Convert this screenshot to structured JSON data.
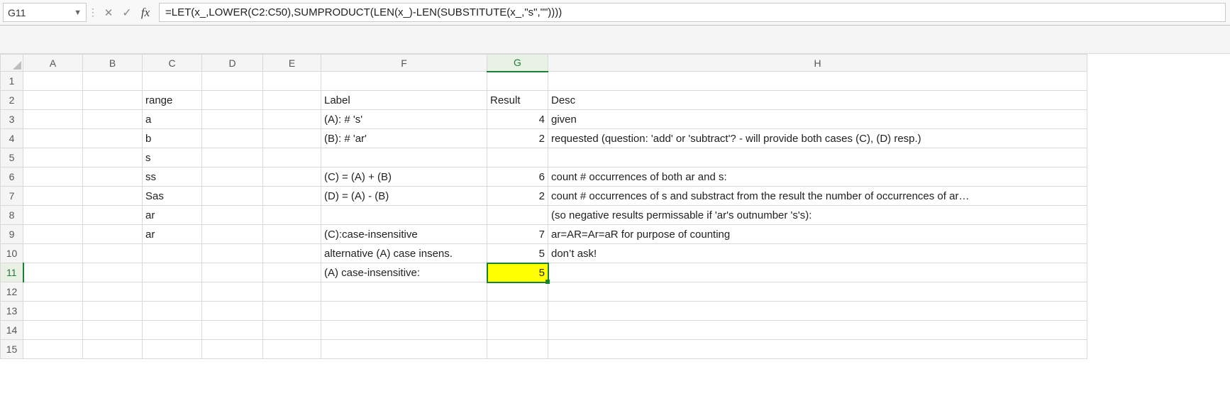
{
  "name_box": "G11",
  "formula": "=LET(x_,LOWER(C2:C50),SUMPRODUCT(LEN(x_)-LEN(SUBSTITUTE(x_,\"s\",\"\"))))",
  "columns": [
    "A",
    "B",
    "C",
    "D",
    "E",
    "F",
    "G",
    "H"
  ],
  "active_col": "G",
  "active_row": 11,
  "row_count": 15,
  "cells": {
    "C2": "range",
    "F2": "Label",
    "G2": "Result",
    "H2": "Desc",
    "C3": "a",
    "F3": "(A): # 's'",
    "G3": "4",
    "H3": "given",
    "C4": "b",
    "F4": "(B): # 'ar'",
    "G4": "2",
    "H4": "requested (question: 'add' or 'subtract'? - will provide both cases (C), (D) resp.)",
    "C5": "s",
    "C6": "ss",
    "F6": "(C) = (A) + (B)",
    "G6": "6",
    "H6": "count # occurrences of both ar and s:",
    "C7": "Sas",
    "F7": "(D) = (A) - (B)",
    "G7": "2",
    "H7": "count # occurrences of s and substract from the result the number of occurrences of ar…",
    "C8": "ar",
    "H8": " (so negative results permissable if 'ar's outnumber 's's):",
    "C9": "ar",
    "F9": "(C):case-insensitive",
    "G9": "7",
    "H9": "ar=AR=Ar=aR for purpose of counting",
    "F10": "alternative (A) case insens.",
    "G10": "5",
    "H10": "don’t ask!",
    "F11": "(A) case-insensitive:",
    "G11": "5"
  },
  "numeric_cols": [
    "G"
  ],
  "text_cols_left": [
    "C",
    "F",
    "H"
  ],
  "g2_is_text": true
}
